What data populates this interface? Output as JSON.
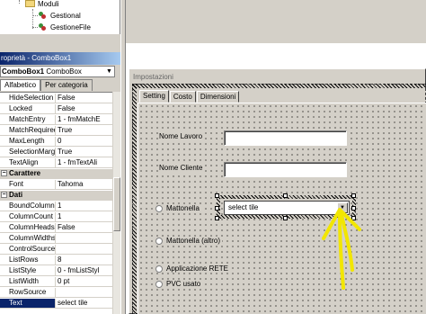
{
  "tree": {
    "folder_label": "Moduli",
    "modules": [
      "Gestional",
      "GestioneFile"
    ]
  },
  "properties": {
    "title": "roprietà - ComboBox1",
    "object_name": "ComboBox1",
    "object_type": "ComboBox",
    "tabs": [
      "Alfabetico",
      "Per categoria"
    ],
    "active_tab": 1,
    "rows": [
      {
        "name": "HideSelection",
        "value": "False"
      },
      {
        "name": "Locked",
        "value": "False"
      },
      {
        "name": "MatchEntry",
        "value": "1 - fmMatchE"
      },
      {
        "name": "MatchRequired",
        "value": "True"
      },
      {
        "name": "MaxLength",
        "value": "0"
      },
      {
        "name": "SelectionMargin",
        "value": "True"
      },
      {
        "name": "TextAlign",
        "value": "1 - fmTextAli"
      },
      {
        "name": "Carattere",
        "value": "",
        "category": true
      },
      {
        "name": "Font",
        "value": "Tahoma"
      },
      {
        "name": "Dati",
        "value": "",
        "category": true
      },
      {
        "name": "BoundColumn",
        "value": "1"
      },
      {
        "name": "ColumnCount",
        "value": "1"
      },
      {
        "name": "ColumnHeads",
        "value": "False"
      },
      {
        "name": "ColumnWidths",
        "value": ""
      },
      {
        "name": "ControlSource",
        "value": ""
      },
      {
        "name": "ListRows",
        "value": "8"
      },
      {
        "name": "ListStyle",
        "value": "0 - fmListStyl"
      },
      {
        "name": "ListWidth",
        "value": "0 pt"
      },
      {
        "name": "RowSource",
        "value": ""
      },
      {
        "name": "Text",
        "value": "select tile",
        "selected": true
      }
    ]
  },
  "form": {
    "title": "Impostazioni",
    "tabs": [
      "Setting",
      "Costo",
      "Dimensioni"
    ],
    "active_tab": 0,
    "labels": {
      "nome_lavoro": "Nome Lavoro",
      "nome_cliente": "Nome Cliente"
    },
    "radios": [
      "Mattonella",
      "Mattonella (altro)",
      "Applicazione RETE",
      "PVC usato"
    ],
    "combo": {
      "text": "select tile"
    }
  },
  "annotation": {
    "color": "#f2e600"
  }
}
